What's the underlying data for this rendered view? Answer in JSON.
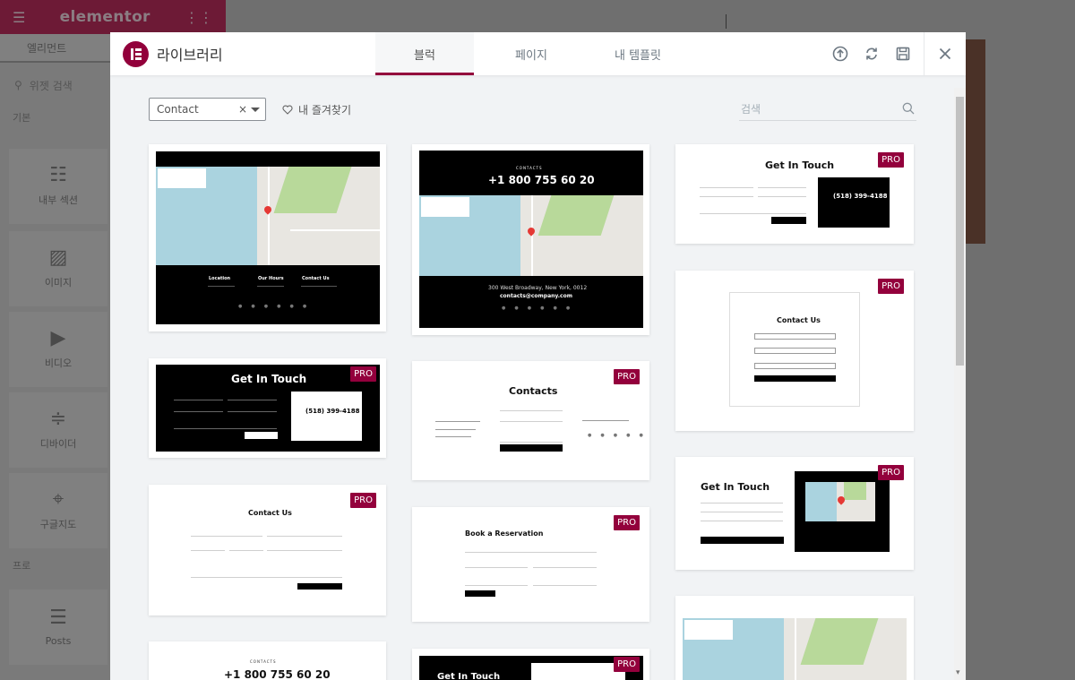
{
  "editor": {
    "logo": "elementor",
    "panel_tab": "엘리먼트",
    "search_placeholder": "위젯 검색",
    "category_basic": "기본",
    "category_pro": "프로",
    "widgets": [
      "내부 섹션",
      "이미지",
      "비디오",
      "디바이더",
      "구글지도",
      "Posts"
    ]
  },
  "modal": {
    "title": "라이브러리",
    "tabs": [
      "블럭",
      "페이지",
      "내 템플릿"
    ],
    "active_tab": "블럭",
    "filter_value": "Contact",
    "filter_clear": "×",
    "favorites_label": "내 즐겨찾기",
    "search_placeholder": "검색",
    "accent_color": "#93003c"
  },
  "cards": {
    "pro_label": "PRO",
    "c1": {
      "col1": "Location",
      "col2": "Our Hours",
      "col3": "Contact Us"
    },
    "c2": {
      "eyebrow": "CONTACTS",
      "phone": "+1 800 755 60 20",
      "address": "300 West Broadway, New York, 0012",
      "email": "contacts@company.com"
    },
    "c3": {
      "title": "Get In Touch",
      "phone": "(518) 399-4188"
    },
    "c4": {
      "title": "Get In Touch",
      "phone": "(518) 399-4188"
    },
    "c5": {
      "title": "Contacts"
    },
    "c6": {
      "title": "Contact Us"
    },
    "c7": {
      "title": "Contact Us"
    },
    "c8": {
      "title": "Book a Reservation"
    },
    "c9": {
      "title": "Get In Touch"
    },
    "c10": {
      "eyebrow": "CONTACTS",
      "phone": "+1 800 755 60 20"
    },
    "c11": {
      "title": "Get In Touch"
    }
  }
}
